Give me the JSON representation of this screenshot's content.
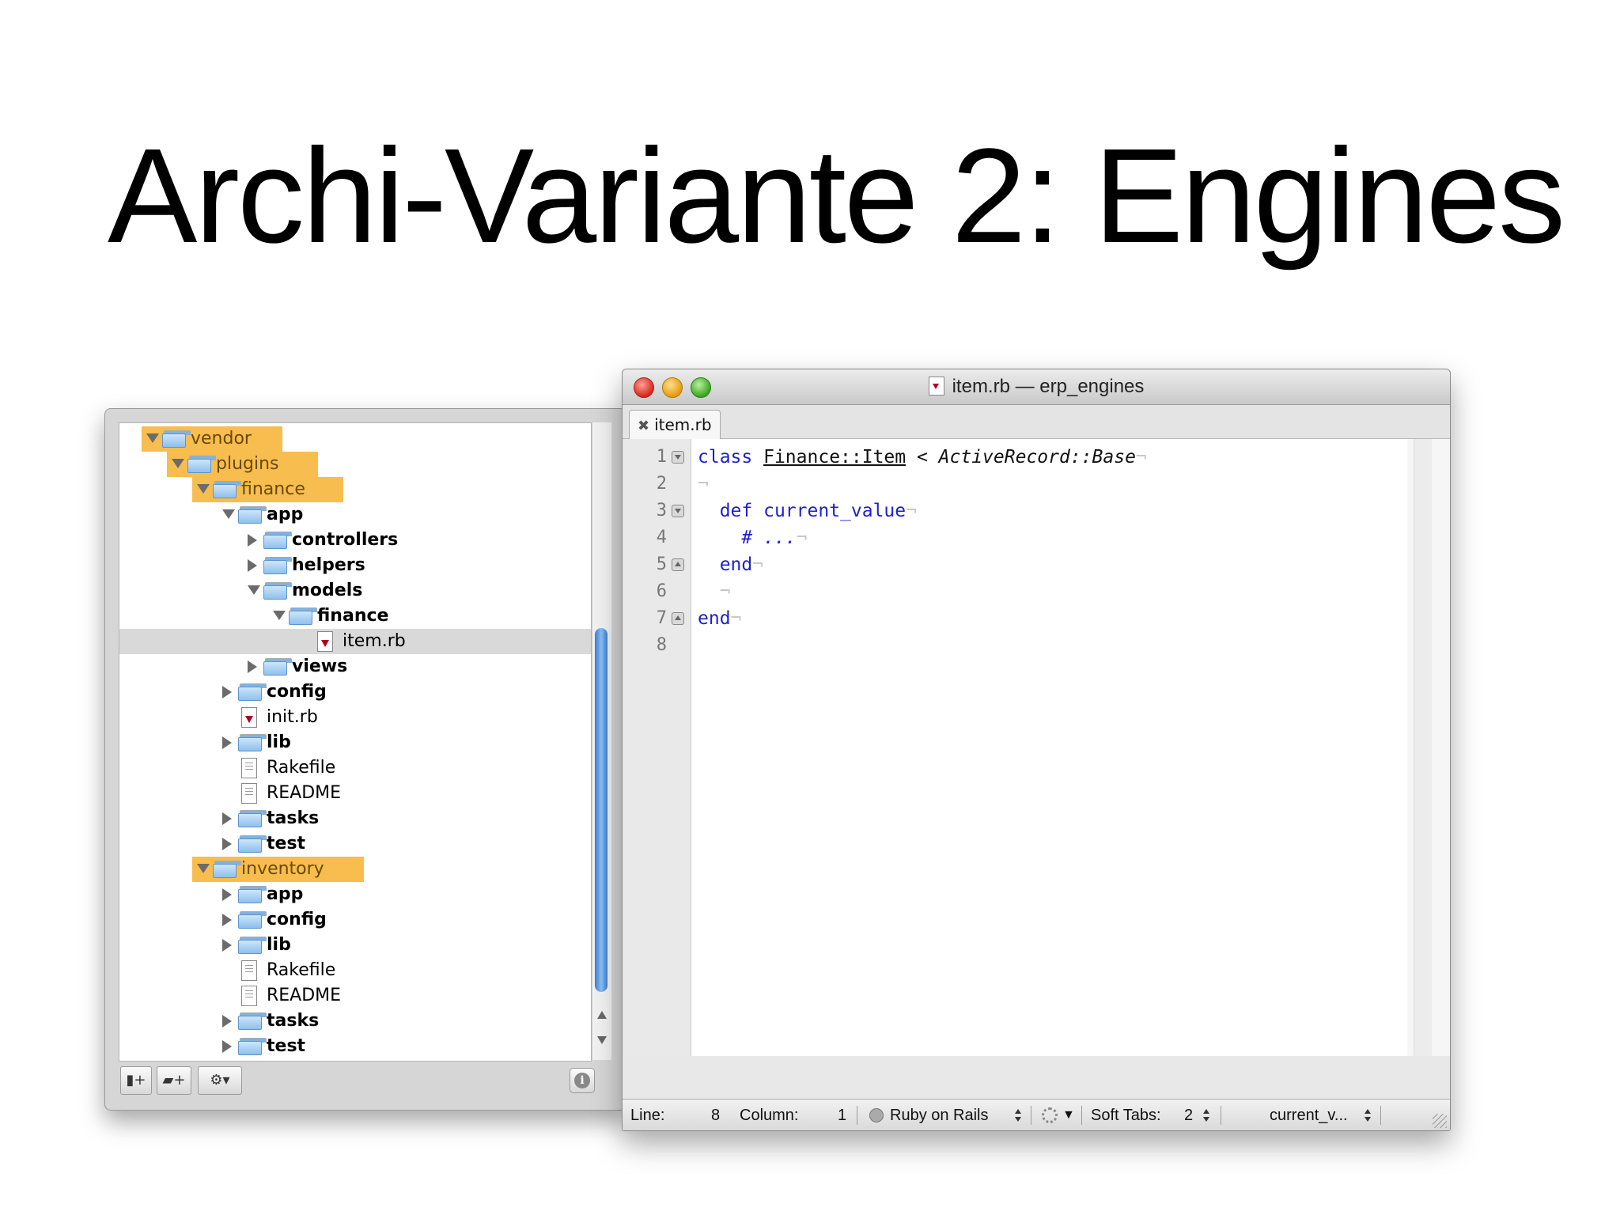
{
  "slide": {
    "title": "Archi-Variante 2: Engines"
  },
  "project_drawer": {
    "tree": [
      {
        "label": "vendor",
        "depth": 0,
        "kind": "folder",
        "state": "open",
        "highlight": true,
        "bold": false
      },
      {
        "label": "plugins",
        "depth": 1,
        "kind": "folder",
        "state": "open",
        "highlight": true,
        "bold": false
      },
      {
        "label": "finance",
        "depth": 2,
        "kind": "folder",
        "state": "open",
        "highlight": true,
        "bold": false
      },
      {
        "label": "app",
        "depth": 3,
        "kind": "folder",
        "state": "open",
        "highlight": false,
        "bold": true
      },
      {
        "label": "controllers",
        "depth": 4,
        "kind": "folder",
        "state": "closed",
        "highlight": false,
        "bold": true
      },
      {
        "label": "helpers",
        "depth": 4,
        "kind": "folder",
        "state": "closed",
        "highlight": false,
        "bold": true
      },
      {
        "label": "models",
        "depth": 4,
        "kind": "folder",
        "state": "open",
        "highlight": false,
        "bold": true
      },
      {
        "label": "finance",
        "depth": 5,
        "kind": "folder",
        "state": "open",
        "highlight": false,
        "bold": true
      },
      {
        "label": "item.rb",
        "depth": 6,
        "kind": "ruby",
        "state": "none",
        "highlight": false,
        "bold": false,
        "selected": true
      },
      {
        "label": "views",
        "depth": 4,
        "kind": "folder",
        "state": "closed",
        "highlight": false,
        "bold": true
      },
      {
        "label": "config",
        "depth": 3,
        "kind": "folder",
        "state": "closed",
        "highlight": false,
        "bold": true
      },
      {
        "label": "init.rb",
        "depth": 3,
        "kind": "ruby",
        "state": "none",
        "highlight": false,
        "bold": false
      },
      {
        "label": "lib",
        "depth": 3,
        "kind": "folder",
        "state": "closed",
        "highlight": false,
        "bold": true
      },
      {
        "label": "Rakefile",
        "depth": 3,
        "kind": "doc",
        "state": "none",
        "highlight": false,
        "bold": false
      },
      {
        "label": "README",
        "depth": 3,
        "kind": "doc",
        "state": "none",
        "highlight": false,
        "bold": false
      },
      {
        "label": "tasks",
        "depth": 3,
        "kind": "folder",
        "state": "closed",
        "highlight": false,
        "bold": true
      },
      {
        "label": "test",
        "depth": 3,
        "kind": "folder",
        "state": "closed",
        "highlight": false,
        "bold": true
      },
      {
        "label": "inventory",
        "depth": 2,
        "kind": "folder",
        "state": "open",
        "highlight": true,
        "bold": false
      },
      {
        "label": "app",
        "depth": 3,
        "kind": "folder",
        "state": "closed",
        "highlight": false,
        "bold": true
      },
      {
        "label": "config",
        "depth": 3,
        "kind": "folder",
        "state": "closed",
        "highlight": false,
        "bold": true
      },
      {
        "label": "lib",
        "depth": 3,
        "kind": "folder",
        "state": "closed",
        "highlight": false,
        "bold": true
      },
      {
        "label": "Rakefile",
        "depth": 3,
        "kind": "doc",
        "state": "none",
        "highlight": false,
        "bold": false
      },
      {
        "label": "README",
        "depth": 3,
        "kind": "doc",
        "state": "none",
        "highlight": false,
        "bold": false
      },
      {
        "label": "tasks",
        "depth": 3,
        "kind": "folder",
        "state": "closed",
        "highlight": false,
        "bold": true
      },
      {
        "label": "test",
        "depth": 3,
        "kind": "folder",
        "state": "closed",
        "highlight": false,
        "bold": true
      }
    ],
    "toolbar": {
      "new_file_icon": "new-file-icon",
      "new_folder_icon": "new-folder-icon",
      "gear_icon": "gear-icon",
      "info_icon": "info-icon"
    },
    "highlight_color": "#f5aa1e"
  },
  "editor": {
    "window_title": "item.rb — erp_engines",
    "tab_label": "item.rb",
    "lines": [
      {
        "n": "1",
        "fold": "start"
      },
      {
        "n": "2",
        "fold": ""
      },
      {
        "n": "3",
        "fold": "start"
      },
      {
        "n": "4",
        "fold": ""
      },
      {
        "n": "5",
        "fold": "end"
      },
      {
        "n": "6",
        "fold": ""
      },
      {
        "n": "7",
        "fold": "end"
      },
      {
        "n": "8",
        "fold": ""
      }
    ],
    "code": {
      "l1_kw": "class",
      "l1_name": "Finance::Item",
      "l1_op": " < ",
      "l1_base": "ActiveRecord::Base",
      "l3_kw": "def",
      "l3_name": "current_value",
      "l4_comment": "# ...",
      "l5_kw": "end",
      "l7_kw": "end",
      "invisible": "¬"
    },
    "status": {
      "line_label": "Line:",
      "line_value": "8",
      "column_label": "Column:",
      "column_value": "1",
      "language": "Ruby on Rails",
      "soft_tabs_label": "Soft Tabs:",
      "soft_tabs_value": "2",
      "symbol": "current_v..."
    },
    "keyword_color": "#1f1fcf"
  }
}
